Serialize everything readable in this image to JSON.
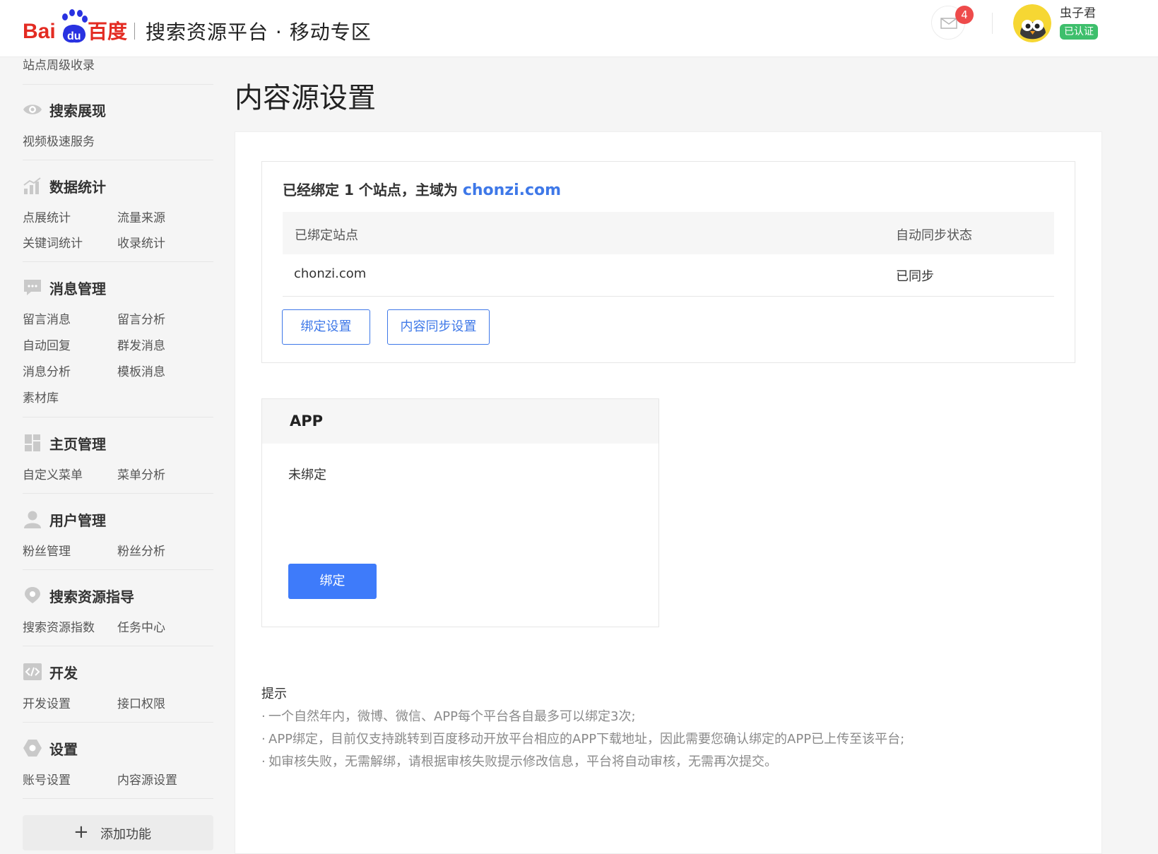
{
  "header": {
    "brand_logo": "Bai du 百度",
    "title": "搜索资源平台 · 移动专区",
    "mail_icon": "mail-icon",
    "unread_count": "4",
    "user": {
      "name": "虫子君",
      "badge": "已认证"
    }
  },
  "sidebar": {
    "top_item": "站点周级收录",
    "sections": [
      {
        "title": "搜索展现",
        "icon": "eye-icon",
        "items": [
          "视频极速服务"
        ]
      },
      {
        "title": "数据统计",
        "icon": "bar-chart-icon",
        "items": [
          "点展统计",
          "流量来源",
          "关键词统计",
          "收录统计"
        ]
      },
      {
        "title": "消息管理",
        "icon": "chat-bubble-icon",
        "items": [
          "留言消息",
          "留言分析",
          "自动回复",
          "群发消息",
          "消息分析",
          "模板消息",
          "素材库"
        ]
      },
      {
        "title": "主页管理",
        "icon": "layout-icon",
        "items": [
          "自定义菜单",
          "菜单分析"
        ]
      },
      {
        "title": "用户管理",
        "icon": "user-icon",
        "items": [
          "粉丝管理",
          "粉丝分析"
        ]
      },
      {
        "title": "搜索资源指导",
        "icon": "location-pin-icon",
        "items": [
          "搜索资源指数",
          "任务中心"
        ]
      },
      {
        "title": "开发",
        "icon": "code-icon",
        "items": [
          "开发设置",
          "接口权限"
        ]
      },
      {
        "title": "设置",
        "icon": "hexagon-settings-icon",
        "items": [
          "账号设置",
          "内容源设置"
        ]
      }
    ],
    "add_feature": "添加功能"
  },
  "main": {
    "page_title": "内容源设置",
    "sites": {
      "summary_prefix": "已经绑定 1 个站点，主域为 ",
      "primary_domain": "chonzi.com",
      "columns": [
        "已绑定站点",
        "自动同步状态"
      ],
      "rows": [
        {
          "site": "chonzi.com",
          "status": "已同步"
        }
      ],
      "buttons": {
        "bind_settings": "绑定设置",
        "sync_settings": "内容同步设置"
      }
    },
    "app": {
      "title": "APP",
      "status": "未绑定",
      "bind_button": "绑定"
    },
    "tips": {
      "title": "提示",
      "items": [
        "一个自然年内，微博、微信、APP每个平台各自最多可以绑定3次;",
        "APP绑定，目前仅支持跳转到百度移动开放平台相应的APP下载地址，因此需要您确认绑定的APP已上传至该平台;",
        "如审核失败，无需解绑，请根据审核失败提示修改信息，平台将自动审核，无需再次提交。"
      ]
    }
  },
  "colors": {
    "accent_blue": "#3e78e8",
    "primary_button": "#3e7bfa",
    "badge_red": "#ee4b4b",
    "verified_green": "#3ebf6c",
    "baidu_red": "#e32b22",
    "baidu_blue": "#2932e1"
  }
}
